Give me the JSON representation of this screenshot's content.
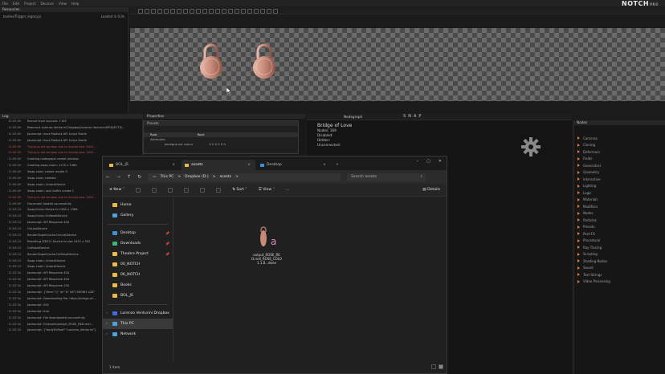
{
  "menubar": {
    "items": [
      "File",
      "Edit",
      "Project",
      "Devices",
      "View",
      "Help"
    ]
  },
  "logo": {
    "name": "NOTCH",
    "edition": "PRO"
  },
  "resources": {
    "title": "Resources",
    "rows": [
      {
        "name": "bodies/Trigger_legacy.js",
        "status": "Loaded in 0.0s"
      }
    ]
  },
  "log": {
    "title": "Log",
    "lines": [
      {
        "t": "12:05:09",
        "m": "Record level success: 1165",
        "err": false
      },
      {
        "t": "12:05:09",
        "m": "Resource Lorenzo Venturini Dropbox/Lorenzo Venturini/PROJECTS/...",
        "err": false
      },
      {
        "t": "12:05:09",
        "m": "Javascript: have Padlock API Script Starts",
        "err": false
      },
      {
        "t": "12:05:09",
        "m": "Javascript: have Padlock API Script Starts",
        "err": false
      },
      {
        "t": "12:05:09",
        "m": "Trying to set window size to invalid size: 3415 ...",
        "err": true
      },
      {
        "t": "12:05:09",
        "m": "Trying to set window size to invalid size: 3415 ...",
        "err": true
      },
      {
        "t": "12:05:09",
        "m": "Creating nodegraph render window",
        "err": false
      },
      {
        "t": "12:05:09",
        "m": "Creating swap chain: 1170 x 1380",
        "err": false
      },
      {
        "t": "12:05:09",
        "m": "Swap chain create results 0",
        "err": false
      },
      {
        "t": "12:05:09",
        "m": "Swap chain created.",
        "err": false
      },
      {
        "t": "12:05:09",
        "m": "Swap chain: UnlockDevice",
        "err": false
      },
      {
        "t": "12:05:09",
        "m": "Swap chain: lock buffer create 1",
        "err": false
      },
      {
        "t": "12:05:09",
        "m": "Trying to set window size to invalid size: 3415 ...",
        "err": true
      },
      {
        "t": "12:05:09",
        "m": "Document loaded successfully",
        "err": false
      },
      {
        "t": "12:05:13",
        "m": "SwapChain::Resize to 1280 x 1366",
        "err": false
      },
      {
        "t": "12:05:13",
        "m": "SwapChain::OnResetDevice",
        "err": false
      },
      {
        "t": "12:05:13",
        "m": "Javascript: API Response 404",
        "err": false
      },
      {
        "t": "12:05:13",
        "m": "OnLostDevice",
        "err": false
      },
      {
        "t": "12:05:13",
        "m": "RenderTargetCache:OnLostDevice",
        "err": false
      },
      {
        "t": "12:05:13",
        "m": "Resetting D3D11 Device to size 2451 x 352",
        "err": false
      },
      {
        "t": "12:05:13",
        "m": "OnResetDevice",
        "err": false
      },
      {
        "t": "12:05:13",
        "m": "RenderTargetCache:OnResetDevice",
        "err": false
      },
      {
        "t": "12:05:13",
        "m": "Swap chain: UnlockDevice",
        "err": false
      },
      {
        "t": "12:05:13",
        "m": "Swap chain: UnlockDevice",
        "err": false
      },
      {
        "t": "12:05:34",
        "m": "Javascript: API Response 404",
        "err": false
      },
      {
        "t": "12:05:34",
        "m": "Javascript: API Response 404",
        "err": false
      },
      {
        "t": "12:05:34",
        "m": "Javascript: API Response 200",
        "err": false
      },
      {
        "t": "12:05:34",
        "m": "Javascript: {\"item\":\"[\" id:\" b\" b8\"1f3f08f1 a28\"",
        "err": false
      },
      {
        "t": "12:05:34",
        "m": "Javascript: Downloading file: https://bridge-of-...",
        "err": false
      },
      {
        "t": "12:05:34",
        "m": "Javascript: 200",
        "err": false
      },
      {
        "t": "12:05:34",
        "m": "Javascript: true",
        "err": false
      },
      {
        "t": "12:05:34",
        "m": "Javascript: File downloaded successfully",
        "err": false
      },
      {
        "t": "12:05:34",
        "m": "Javascript: D:\\assets\\output_ROSE_RED.mdl...",
        "err": false
      },
      {
        "t": "12:05:34",
        "m": "Javascript: {\"bodyEuRoot\":\"Lorenzo_Venturini\"}",
        "err": false
      }
    ]
  },
  "properties": {
    "title": "Properties",
    "presets": "Presets",
    "row1_name": "Root",
    "row1_val": "Root",
    "row2": "Attributes",
    "row3": "background colour",
    "row3_val": "0 0 0 0 0 0"
  },
  "nodegraph": {
    "title": "Nodegraph",
    "toolbar_letters": [
      "S",
      "N",
      "A",
      "P"
    ],
    "info_title": "Bridge of Love",
    "info_nodes": "Nodes: 169",
    "info_disabled": "Disabled:",
    "info_hidden": "Hidden:",
    "info_unconnected": "Unconnected:"
  },
  "nodes": {
    "title": "Nodes",
    "items": [
      "Cameras",
      "Cloning",
      "Deformers",
      "Fields",
      "Generators",
      "Geometry",
      "Interactive",
      "Lighting",
      "Logic",
      "Materials",
      "Modifiers",
      "Nodes",
      "Particles",
      "Presets",
      "Post-FX",
      "Procedural",
      "Ray Tracing",
      "Scripting",
      "Shading Nodes",
      "Sound",
      "Text Strings",
      "Video Processing"
    ],
    "accent": "#e87b3a"
  },
  "explorer": {
    "tabs": [
      {
        "label": "BOL_JS",
        "active": false
      },
      {
        "label": "assets",
        "active": true
      },
      {
        "label": "Desktop",
        "active": false
      }
    ],
    "crumbs": [
      "This PC",
      ">",
      "Dropbox (D:)",
      ">",
      "assets",
      ">"
    ],
    "search_placeholder": "Search assets",
    "new_label": "New",
    "sort_label": "Sort",
    "view_label": "View",
    "more_label": "...",
    "details_label": "Details",
    "nav": [
      {
        "label": "Home",
        "color": "#e9b949",
        "sel": false,
        "pin": false
      },
      {
        "label": "Gallery",
        "color": "#4aa3df",
        "sel": false,
        "pin": false
      },
      {
        "sep": true
      },
      {
        "label": "Desktop",
        "color": "#3d8fd6",
        "sel": false,
        "pin": true
      },
      {
        "label": "Downloads",
        "color": "#3ab67a",
        "sel": false,
        "pin": true
      },
      {
        "label": "Theatre Project",
        "color": "#e9b949",
        "sel": false,
        "pin": true
      },
      {
        "label": "00_NOTCH",
        "color": "#e9b949",
        "sel": false,
        "pin": false
      },
      {
        "label": "06_NOTCH",
        "color": "#e9b949",
        "sel": false,
        "pin": false
      },
      {
        "label": "Books",
        "color": "#e9b949",
        "sel": false,
        "pin": false
      },
      {
        "label": "BOL_JS",
        "color": "#e9b949",
        "sel": false,
        "pin": false
      },
      {
        "sep": true
      },
      {
        "label": "Lorenzo Venturini Dropbox",
        "color": "#3d6fe0",
        "sel": false,
        "pin": false,
        "chev": true
      },
      {
        "label": "This PC",
        "color": "#4aa3df",
        "sel": true,
        "pin": false,
        "chev": true
      },
      {
        "label": "Network",
        "color": "#4aa3df",
        "sel": false,
        "pin": false,
        "chev": true
      }
    ],
    "file": {
      "name_line1": "output_ROSE_RE",
      "name_line2": "D.mdl_ROSE_COLO",
      "name_line3": "1.1.8...done"
    },
    "status": "1 item"
  }
}
